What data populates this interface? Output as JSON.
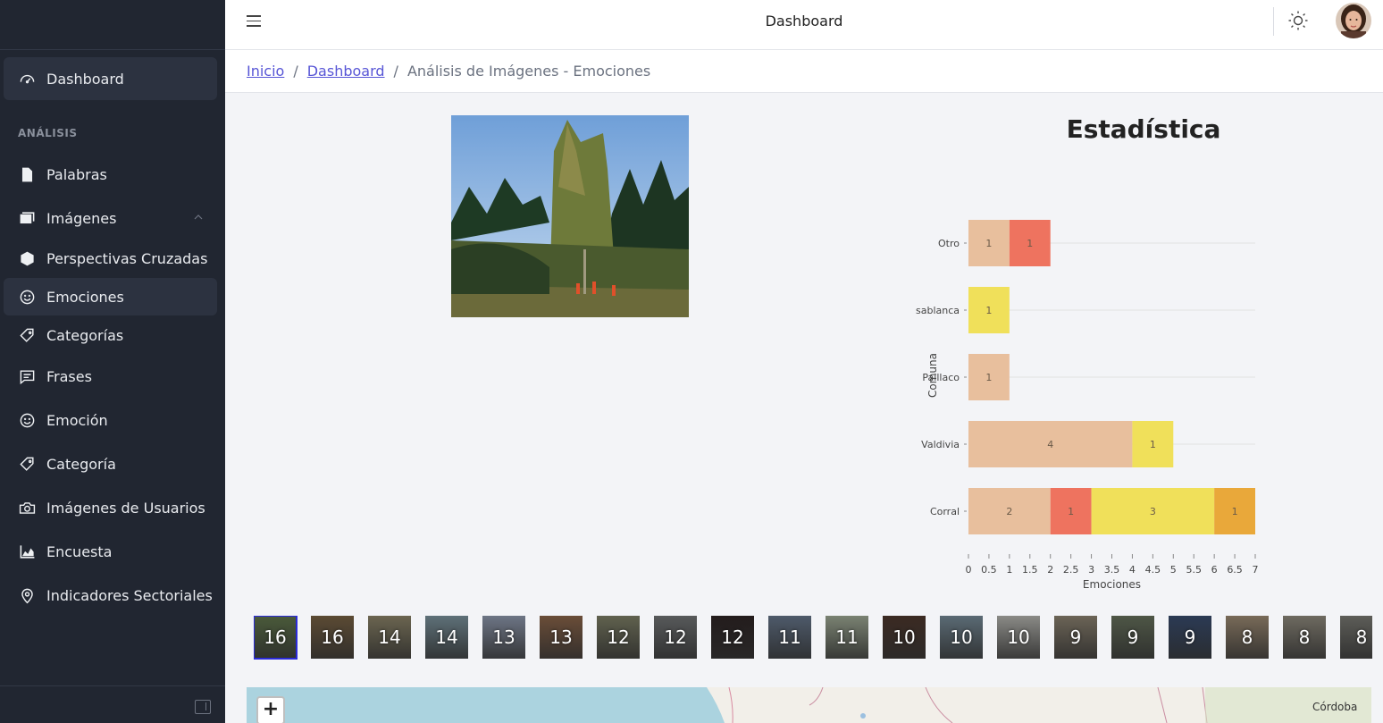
{
  "header": {
    "title": "Dashboard"
  },
  "breadcrumb": {
    "home": "Inicio",
    "dashboard": "Dashboard",
    "sep": "/",
    "current": "Análisis de Imágenes - Emociones"
  },
  "sidebar": {
    "section_label": "ANÁLISIS",
    "items": [
      {
        "label": "Dashboard",
        "icon": "speedometer-icon"
      },
      {
        "label": "Palabras",
        "icon": "document-icon"
      },
      {
        "label": "Imágenes",
        "icon": "images-icon"
      },
      {
        "label": "Perspectivas Cruzadas",
        "icon": "cube-icon"
      },
      {
        "label": "Emociones",
        "icon": "smile-icon"
      },
      {
        "label": "Categorías",
        "icon": "tag-icon"
      },
      {
        "label": "Frases",
        "icon": "chat-icon"
      },
      {
        "label": "Emoción",
        "icon": "smile-icon"
      },
      {
        "label": "Categoría",
        "icon": "tag-icon"
      },
      {
        "label": "Imágenes de Usuarios",
        "icon": "camera-icon"
      },
      {
        "label": "Encuesta",
        "icon": "area-chart-icon"
      },
      {
        "label": "Indicadores Sectoriales",
        "icon": "location-pin-icon"
      }
    ]
  },
  "chart_title": "Estadística",
  "chart_data": {
    "type": "bar",
    "orientation": "horizontal",
    "stacked": true,
    "categories": [
      "Corral",
      "Valdivia",
      "Paillaco",
      "sablanca",
      "Otro"
    ],
    "series": [
      {
        "values": [
          2,
          4,
          1,
          0,
          1
        ],
        "color": "#e8bf9d"
      },
      {
        "values": [
          1,
          0,
          0,
          0,
          1
        ],
        "color": "#ee735f"
      },
      {
        "values": [
          3,
          1,
          0,
          1,
          0
        ],
        "color": "#f0e05a"
      },
      {
        "values": [
          1,
          0,
          0,
          0,
          0
        ],
        "color": "#e9a83a"
      }
    ],
    "xlabel": "Emociones",
    "ylabel": "Comuna",
    "xlim": [
      0,
      7
    ],
    "xticks": [
      "0",
      "0.5",
      "1",
      "1.5",
      "2",
      "2.5",
      "3",
      "3.5",
      "4",
      "4.5",
      "5",
      "5.5",
      "6",
      "6.5",
      "7"
    ],
    "grid": true
  },
  "thumbnails": [
    {
      "count": "16",
      "color": "#4a5a3a"
    },
    {
      "count": "16",
      "color": "#5b4a33"
    },
    {
      "count": "14",
      "color": "#6b6550"
    },
    {
      "count": "14",
      "color": "#5e7078"
    },
    {
      "count": "13",
      "color": "#6d7585"
    },
    {
      "count": "13",
      "color": "#6a4d38"
    },
    {
      "count": "12",
      "color": "#60614e"
    },
    {
      "count": "12",
      "color": "#57595a"
    },
    {
      "count": "12",
      "color": "#231c1c"
    },
    {
      "count": "11",
      "color": "#4e5a6a"
    },
    {
      "count": "11",
      "color": "#7a8272"
    },
    {
      "count": "10",
      "color": "#3b2a22"
    },
    {
      "count": "10",
      "color": "#5a6a74"
    },
    {
      "count": "10",
      "color": "#8a8a86"
    },
    {
      "count": "9",
      "color": "#6b6456"
    },
    {
      "count": "9",
      "color": "#4e5646"
    },
    {
      "count": "9",
      "color": "#2b3a54"
    },
    {
      "count": "8",
      "color": "#786a58"
    },
    {
      "count": "8",
      "color": "#6e6a60"
    },
    {
      "count": "8",
      "color": "#5d5d58"
    }
  ],
  "map": {
    "zoom_in": "+",
    "city": "Córdoba"
  }
}
